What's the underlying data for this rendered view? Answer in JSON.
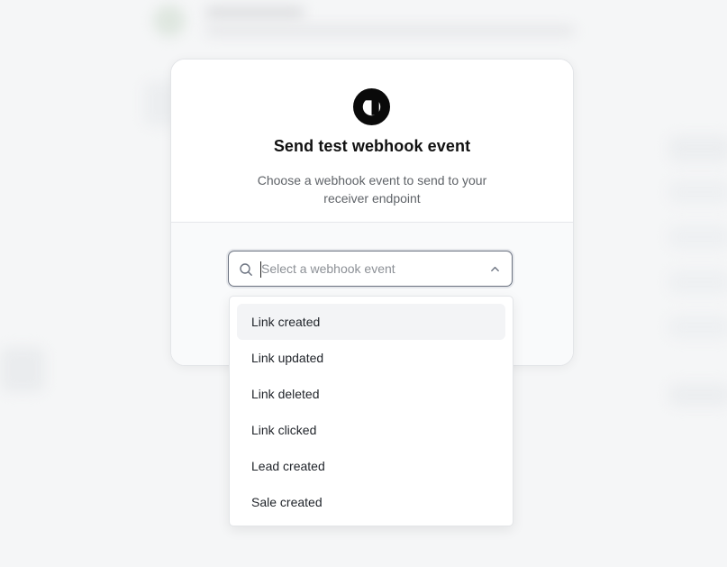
{
  "modal": {
    "title": "Send test webhook event",
    "subtitle": "Choose a webhook event to send to your receiver endpoint"
  },
  "select": {
    "placeholder": "Select a webhook event",
    "value": ""
  },
  "dropdown": {
    "options": [
      {
        "label": "Link created"
      },
      {
        "label": "Link updated"
      },
      {
        "label": "Link deleted"
      },
      {
        "label": "Link clicked"
      },
      {
        "label": "Lead created"
      },
      {
        "label": "Sale created"
      }
    ]
  },
  "icons": {
    "logo": "dub-logo-icon",
    "search": "search-icon",
    "chevron": "chevron-up-icon"
  },
  "colors": {
    "highlighted_option": "#f3f4f6",
    "title": "#111111",
    "subtitle": "#5f6368"
  }
}
